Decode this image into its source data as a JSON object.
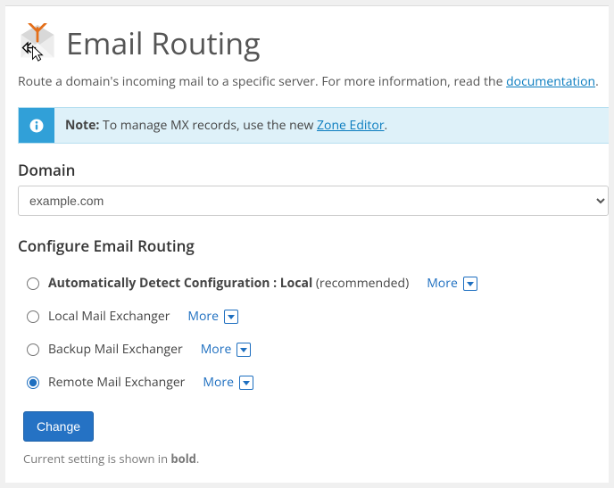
{
  "header": {
    "title": "Email Routing"
  },
  "intro": {
    "prefix": "Route a domain's incoming mail to a specific server. For more information, read the ",
    "link_text": "documentation",
    "suffix": "."
  },
  "alert": {
    "note_label": "Note:",
    "text_before_link": " To manage MX records, use the new ",
    "link_text": "Zone Editor",
    "text_after_link": "."
  },
  "domain": {
    "label": "Domain",
    "selected": "example.com"
  },
  "configure": {
    "label": "Configure Email Routing",
    "options": [
      {
        "label": "Automatically Detect Configuration : Local",
        "recommended": "(recommended)",
        "bold": true,
        "selected": false
      },
      {
        "label": "Local Mail Exchanger",
        "recommended": "",
        "bold": false,
        "selected": false
      },
      {
        "label": "Backup Mail Exchanger",
        "recommended": "",
        "bold": false,
        "selected": false
      },
      {
        "label": "Remote Mail Exchanger",
        "recommended": "",
        "bold": false,
        "selected": true
      }
    ],
    "more_label": "More"
  },
  "actions": {
    "change_button": "Change"
  },
  "footnote": {
    "prefix": "Current setting is shown in ",
    "bold_word": "bold",
    "suffix": "."
  }
}
